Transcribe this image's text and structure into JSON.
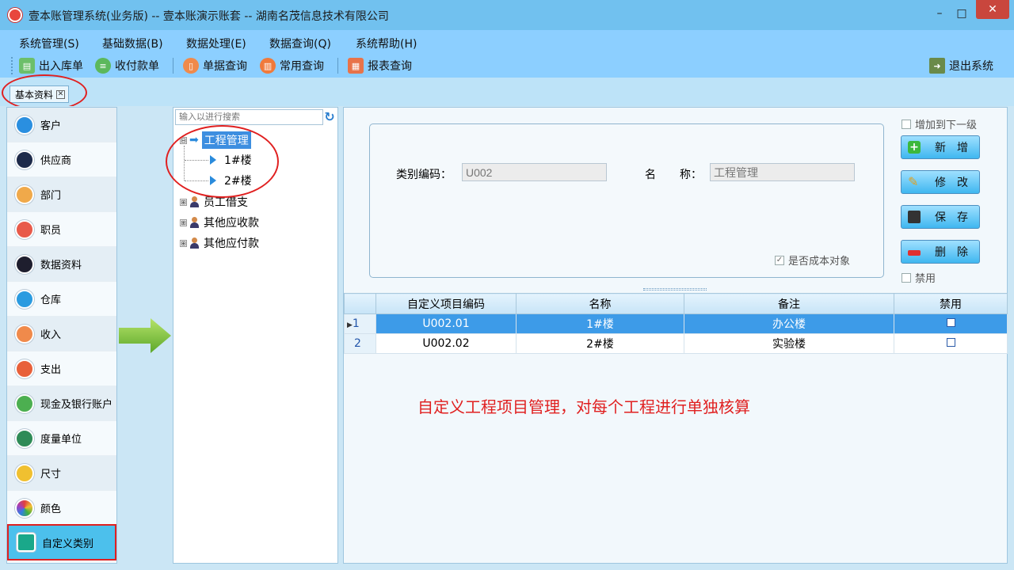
{
  "window": {
    "title": "壹本账管理系统(业务版) -- 壹本账演示账套 -- 湖南名茂信息技术有限公司",
    "controls": {
      "minimize": "–",
      "maximize": "□",
      "close": "✕"
    }
  },
  "menu": [
    "系统管理(S)",
    "基础数据(B)",
    "数据处理(E)",
    "数据查询(Q)",
    "系统帮助(H)"
  ],
  "toolbar": {
    "items": [
      "出入库单",
      "收付款单",
      "单据查询",
      "常用查询",
      "报表查询"
    ],
    "exit": "退出系统"
  },
  "tabs": [
    {
      "label": "基本资料",
      "close": "✕"
    }
  ],
  "sidebar": {
    "items": [
      "客户",
      "供应商",
      "部门",
      "职员",
      "数据资料",
      "仓库",
      "收入",
      "支出",
      "现金及银行账户",
      "度量单位",
      "尺寸",
      "颜色",
      "自定义类别"
    ],
    "selected": "自定义类别"
  },
  "tree": {
    "search_placeholder": "输入以进行搜索",
    "expand_symbol": "⊟",
    "collapse_symbol": "⊞",
    "root": {
      "label": "工程管理",
      "children": [
        "1#楼",
        "2#楼"
      ]
    },
    "others": [
      "员工借支",
      "其他应收款",
      "其他应付款"
    ]
  },
  "form": {
    "code_label": "类别编码：",
    "code_value": "U002",
    "name_label_1": "名",
    "name_label_2": "称：",
    "name_value": "工程管理",
    "cost_object_label": "是否成本对象",
    "cost_object_checked": true,
    "add_sublevel_label": "增加到下一级",
    "disabled_label": "禁用"
  },
  "actions": [
    "新　增",
    "修　改",
    "保　存",
    "删　除"
  ],
  "grid": {
    "columns": [
      "自定义项目编码",
      "名称",
      "备注",
      "禁用"
    ],
    "rows": [
      {
        "num": "1",
        "code": "U002.01",
        "name": "1#楼",
        "note": "办公楼",
        "disabled": false
      },
      {
        "num": "2",
        "code": "U002.02",
        "name": "2#楼",
        "note": "实验楼",
        "disabled": false
      }
    ]
  },
  "annotation": "自定义工程项目管理，对每个工程进行单独核算",
  "colors": {
    "accent": "#3d9be8",
    "highlight_red": "#e02020",
    "menu_bg": "#8ccfff"
  }
}
